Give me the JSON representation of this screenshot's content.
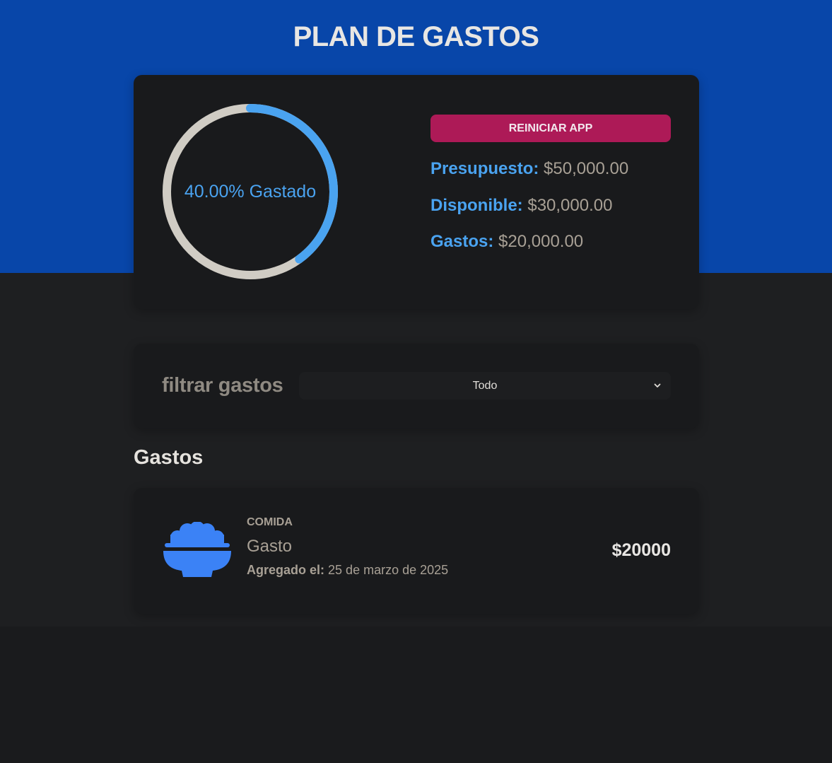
{
  "header": {
    "title": "PLAN DE GASTOS"
  },
  "budget": {
    "spent_fraction": 0.4,
    "progress_label": "40.00% Gastado",
    "reset_label": "REINICIAR APP",
    "budget_label": "Presupuesto:",
    "budget_value": "$50,000.00",
    "available_label": "Disponible:",
    "available_value": "$30,000.00",
    "spent_label": "Gastos:",
    "spent_value": "$20,000.00",
    "colors": {
      "progress": "#4aa3f0",
      "track": "#d0ccc4",
      "reset": "#ad1a57"
    }
  },
  "filter": {
    "label": "filtrar gastos",
    "selected": "Todo"
  },
  "expenses": {
    "title": "Gastos",
    "items": [
      {
        "category": "COMIDA",
        "name": "Gasto",
        "date_label": "Agregado el:",
        "date_value": "25 de marzo de 2025",
        "amount": "$20000",
        "icon": "food-bowl-icon"
      }
    ]
  }
}
